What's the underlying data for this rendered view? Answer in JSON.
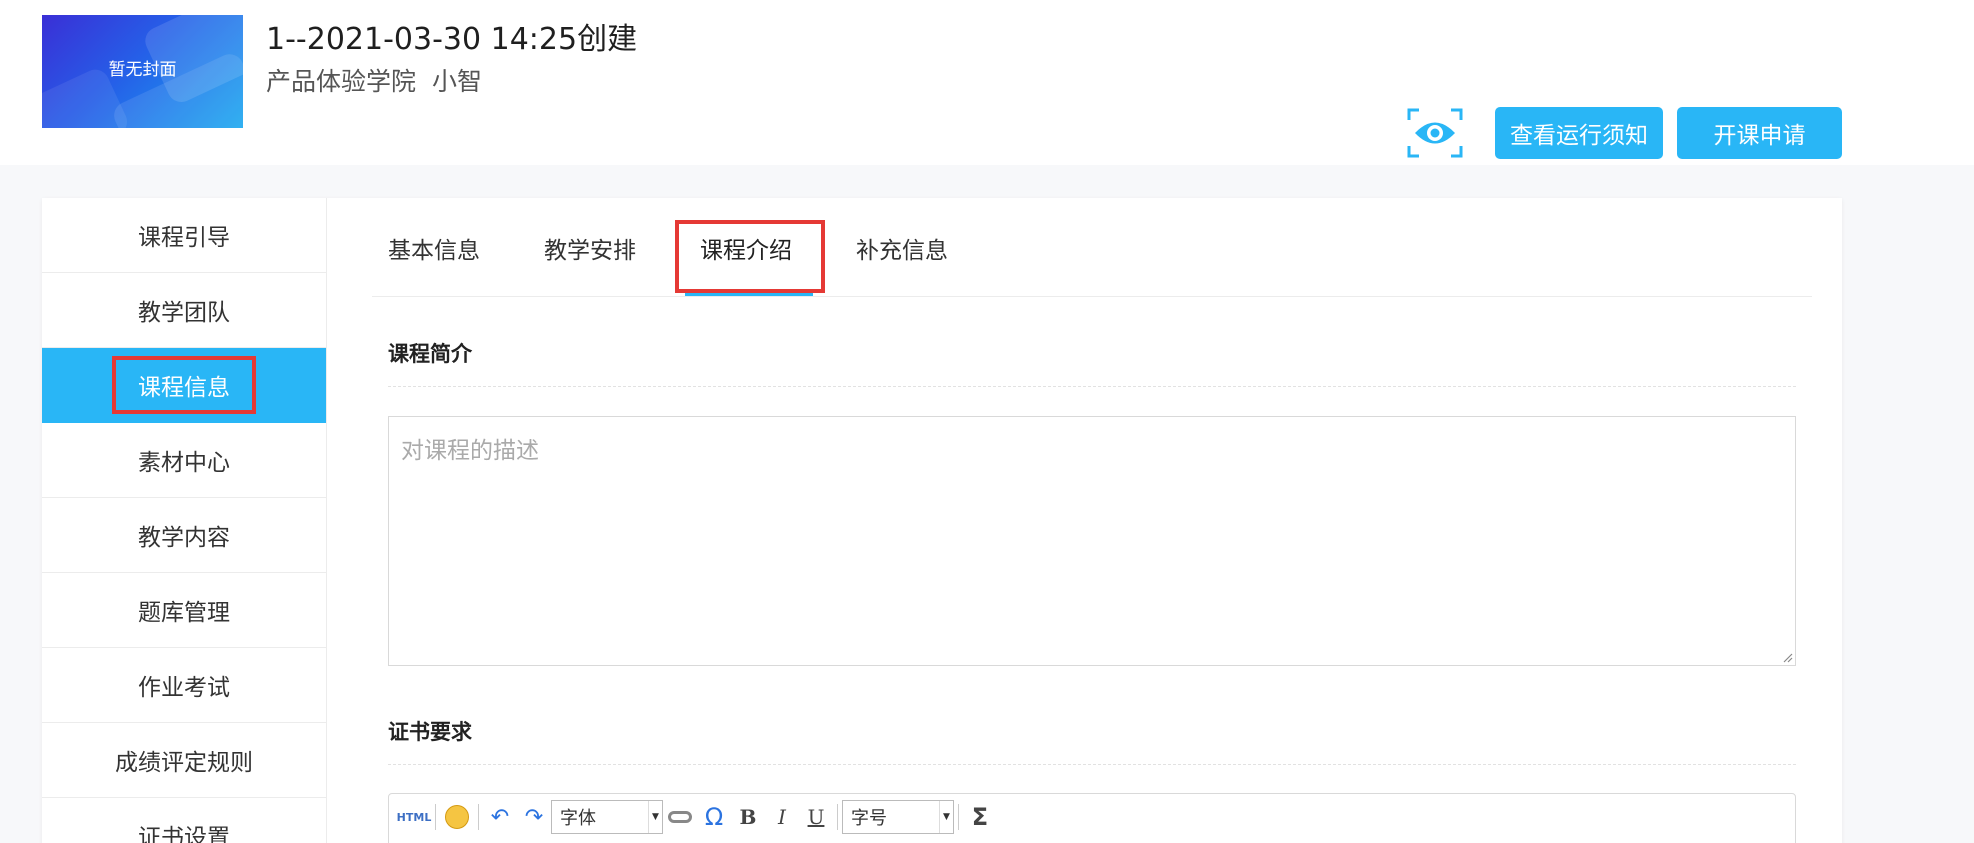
{
  "header": {
    "cover_text": "暂无封面",
    "title": "1--2021-03-30 14:25创建",
    "school": "产品体验学院",
    "teacher": "小智",
    "notice_button": "查看运行须知",
    "apply_button": "开课申请"
  },
  "sidebar": {
    "items": [
      {
        "label": "课程引导"
      },
      {
        "label": "教学团队"
      },
      {
        "label": "课程信息"
      },
      {
        "label": "素材中心"
      },
      {
        "label": "教学内容"
      },
      {
        "label": "题库管理"
      },
      {
        "label": "作业考试"
      },
      {
        "label": "成绩评定规则"
      },
      {
        "label": "证书设置"
      }
    ],
    "active_index": 2
  },
  "tabs": [
    {
      "label": "基本信息"
    },
    {
      "label": "教学安排"
    },
    {
      "label": "课程介绍"
    },
    {
      "label": "补充信息"
    }
  ],
  "intro": {
    "section_title": "课程简介",
    "placeholder": "对课程的描述"
  },
  "certificate": {
    "section_title": "证书要求"
  },
  "editor": {
    "font_select": "字体",
    "size_select": "字号",
    "html_label": "HTML"
  },
  "colors": {
    "accent": "#29b6f6",
    "highlight": "#e53935"
  }
}
